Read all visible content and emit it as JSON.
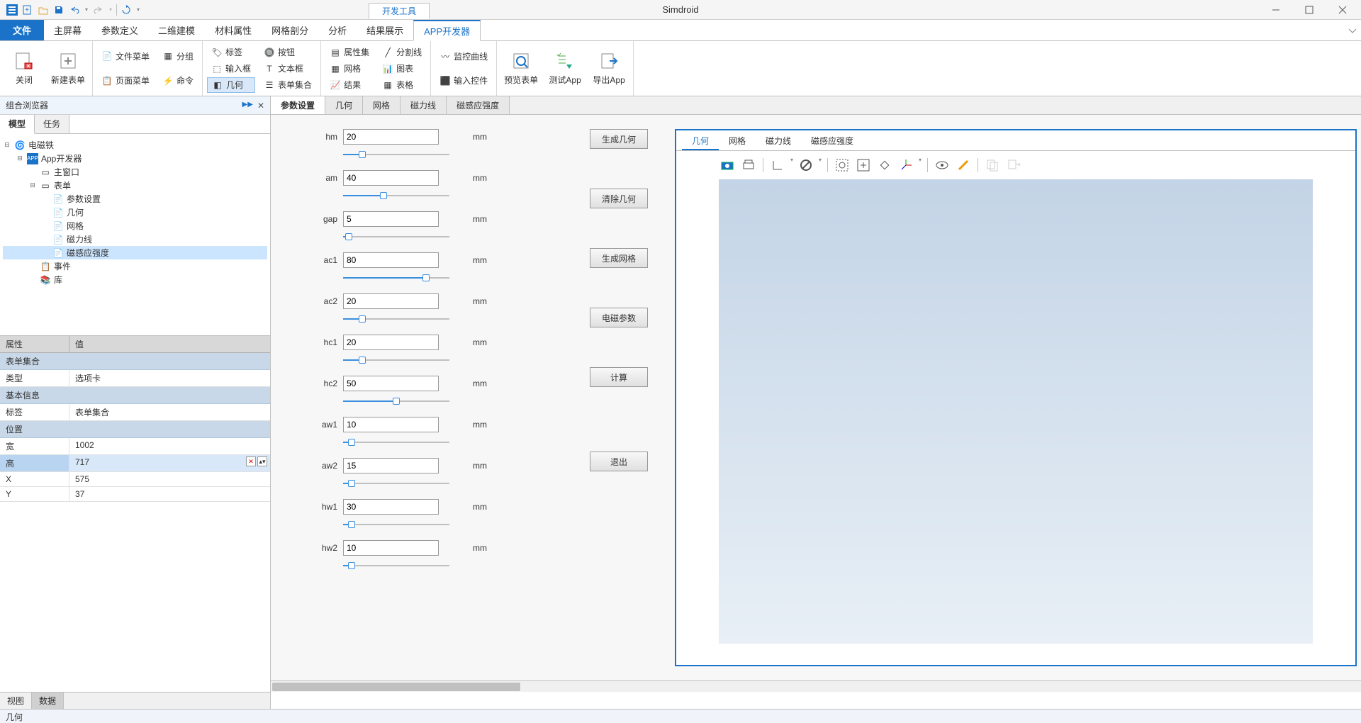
{
  "app": {
    "title": "Simdroid",
    "dev_tools_tab": "开发工具"
  },
  "menu": {
    "file": "文件",
    "items": [
      "主屏幕",
      "参数定义",
      "二维建模",
      "材料属性",
      "网格剖分",
      "分析",
      "结果展示",
      "APP开发器"
    ],
    "active_index": 7
  },
  "ribbon": {
    "close": "关闭",
    "new_form": "新建表单",
    "file_menu": "文件菜单",
    "group": "分组",
    "page_menu": "页面菜单",
    "cmd": "命令",
    "tag": "标签",
    "button": "按钮",
    "input": "输入框",
    "textbox": "文本框",
    "geom": "几何",
    "form_set": "表单集合",
    "prop_set": "属性集",
    "split_line": "分割线",
    "grid": "网格",
    "chart": "图表",
    "result": "结果",
    "table": "表格",
    "monitor_curve": "监控曲线",
    "input_ctrl": "输入控件",
    "preview_form": "预览表单",
    "test_app": "测试App",
    "export_app": "导出App"
  },
  "leftpanel": {
    "title": "组合浏览器",
    "tabs": [
      "模型",
      "任务"
    ],
    "active_tab": 0,
    "tree": {
      "root": "电磁铁",
      "app_dev": "App开发器",
      "main_win": "主窗口",
      "forms": "表单",
      "form_items": [
        "参数设置",
        "几何",
        "网格",
        "磁力线",
        "磁感应强度"
      ],
      "selected_form": 4,
      "events": "事件",
      "library": "库"
    },
    "prop": {
      "header": [
        "属性",
        "值"
      ],
      "group1": "表单集合",
      "type": "类型",
      "type_val": "选项卡",
      "group2": "基本信息",
      "label": "标签",
      "label_val": "表单集合",
      "group3": "位置",
      "w": "宽",
      "w_val": "1002",
      "h": "高",
      "h_val": "717",
      "x": "X",
      "x_val": "575",
      "y": "Y",
      "y_val": "37"
    },
    "bottom_tabs": [
      "视图",
      "数据"
    ],
    "bottom_active": 1
  },
  "doctabs": [
    "参数设置",
    "几何",
    "网格",
    "磁力线",
    "磁感应强度"
  ],
  "doctab_active": 0,
  "params": [
    {
      "name": "hm",
      "value": "20",
      "unit": "mm",
      "pct": 18
    },
    {
      "name": "am",
      "value": "40",
      "unit": "mm",
      "pct": 38
    },
    {
      "name": "gap",
      "value": "5",
      "unit": "mm",
      "pct": 5
    },
    {
      "name": "ac1",
      "value": "80",
      "unit": "mm",
      "pct": 78
    },
    {
      "name": "ac2",
      "value": "20",
      "unit": "mm",
      "pct": 18
    },
    {
      "name": "hc1",
      "value": "20",
      "unit": "mm",
      "pct": 18
    },
    {
      "name": "hc2",
      "value": "50",
      "unit": "mm",
      "pct": 50
    },
    {
      "name": "aw1",
      "value": "10",
      "unit": "mm",
      "pct": 8
    },
    {
      "name": "aw2",
      "value": "15",
      "unit": "mm",
      "pct": 8
    },
    {
      "name": "hw1",
      "value": "30",
      "unit": "mm",
      "pct": 8
    },
    {
      "name": "hw2",
      "value": "10",
      "unit": "mm",
      "pct": 8
    }
  ],
  "actions": {
    "gen_geom": "生成几何",
    "clear_geom": "清除几何",
    "gen_mesh": "生成网格",
    "em_params": "电磁参数",
    "compute": "计算",
    "exit": "退出"
  },
  "preview": {
    "tabs": [
      "几何",
      "网格",
      "磁力线",
      "磁感应强度"
    ],
    "active": 0
  },
  "statusbar": {
    "text": "几何"
  }
}
